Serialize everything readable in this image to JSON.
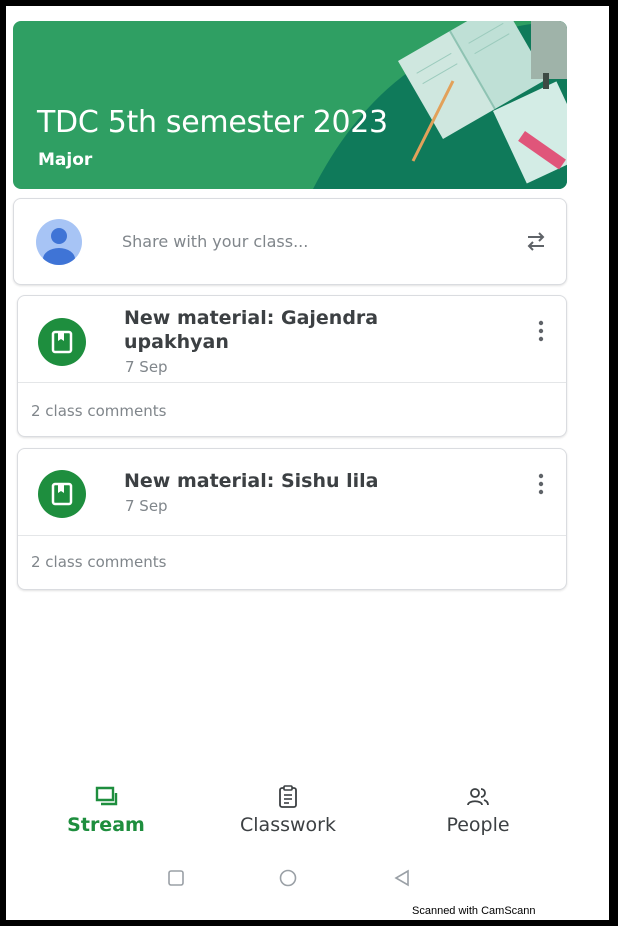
{
  "banner": {
    "title": "TDC 5th semester 2023",
    "section": "Major",
    "color": "#2f9f63"
  },
  "share": {
    "placeholder": "Share with your class...",
    "avatar_icon": "account-avatar-icon",
    "repost_icon": "repost-icon"
  },
  "posts": [
    {
      "title": "New material: Gajendra upakhyan",
      "date": "7 Sep",
      "comments": "2 class comments",
      "icon": "material-icon"
    },
    {
      "title": "New material: Sishu lila",
      "date": "7 Sep",
      "comments": "2 class comments",
      "icon": "material-icon"
    }
  ],
  "bottom_nav": {
    "items": [
      {
        "label": "Stream",
        "icon": "stream-icon",
        "active": true
      },
      {
        "label": "Classwork",
        "icon": "classwork-icon",
        "active": false
      },
      {
        "label": "People",
        "icon": "people-icon",
        "active": false
      }
    ],
    "active_color": "#1e8e3e"
  },
  "system_nav": {
    "icons": [
      "recents-icon",
      "home-icon",
      "back-icon"
    ]
  },
  "watermark": "Scanned with CamScann"
}
